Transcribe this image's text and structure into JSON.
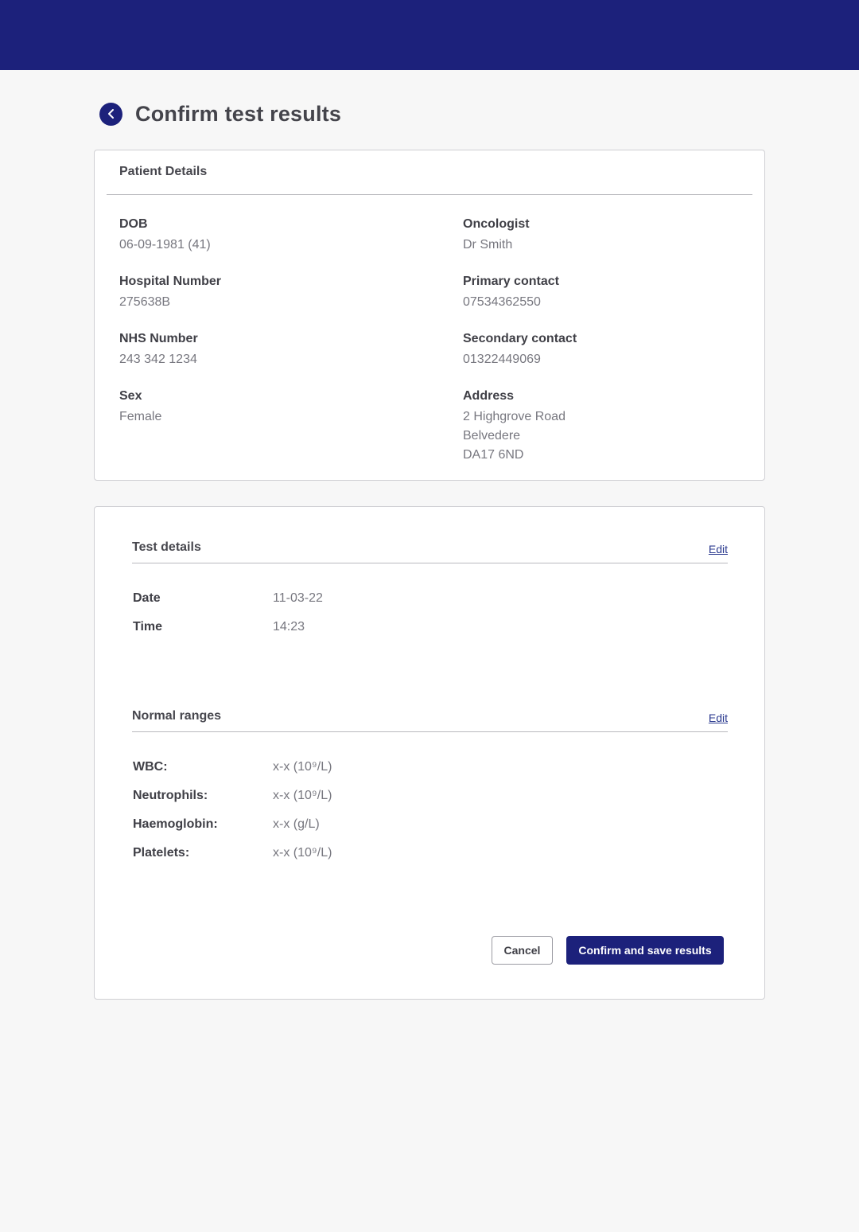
{
  "header": {
    "title": "Confirm test results"
  },
  "patient": {
    "heading": "Patient Details",
    "left": [
      {
        "label": "DOB",
        "value": "06-09-1981 (41)"
      },
      {
        "label": "Hospital Number",
        "value": "275638B"
      },
      {
        "label": "NHS Number",
        "value": "243 342 1234"
      },
      {
        "label": "Sex",
        "value": "Female"
      }
    ],
    "right": [
      {
        "label": "Oncologist",
        "value": "Dr Smith"
      },
      {
        "label": "Primary contact",
        "value": "07534362550"
      },
      {
        "label": "Secondary contact",
        "value": "01322449069"
      },
      {
        "label": "Address",
        "lines": [
          "2 Highgrove Road",
          "Belvedere",
          "DA17 6ND"
        ]
      }
    ]
  },
  "test_details": {
    "heading": "Test details",
    "edit_label": "Edit",
    "rows": [
      {
        "key": "Date",
        "value": "11-03-22"
      },
      {
        "key": "Time",
        "value": "14:23"
      }
    ]
  },
  "normal_ranges": {
    "heading": "Normal ranges",
    "edit_label": "Edit",
    "rows": [
      {
        "key": "WBC:",
        "value": "x-x (10⁹/L)"
      },
      {
        "key": "Neutrophils:",
        "value": "x-x (10⁹/L)"
      },
      {
        "key": "Haemoglobin:",
        "value": "x-x (g/L)"
      },
      {
        "key": "Platelets:",
        "value": "x-x (10⁹/L)"
      }
    ]
  },
  "actions": {
    "cancel_label": "Cancel",
    "confirm_label": "Confirm and save results"
  },
  "colors": {
    "brand": "#1c217b",
    "background": "#f7f7f7"
  },
  "icons": {
    "back": "chevron-left-icon"
  }
}
